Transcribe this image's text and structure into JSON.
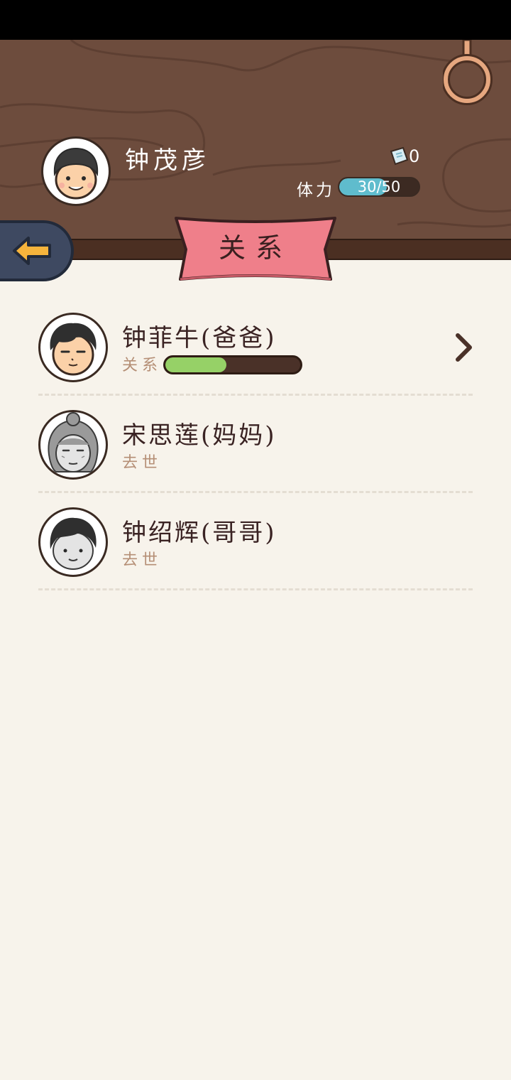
{
  "player": {
    "name": "钟茂彦",
    "ticket_count": "0",
    "stamina_label": "体力",
    "stamina_text": "30/50",
    "stamina_fraction": 0.6
  },
  "title": "关系",
  "relations": [
    {
      "name": "钟菲牛(爸爸)",
      "status": "关系",
      "alive": true,
      "relationship_fraction": 0.45
    },
    {
      "name": "宋思莲(妈妈)",
      "status": "去世",
      "alive": false
    },
    {
      "name": "钟绍辉(哥哥)",
      "status": "去世",
      "alive": false
    }
  ],
  "colors": {
    "wood": "#6d4c3d",
    "banner": "#ef7f8a",
    "stamina": "#5fbccd",
    "relationship": "#96d167",
    "background": "#f7f3eb"
  },
  "icons": [
    "back-arrow-icon",
    "ticket-icon",
    "hook-icon",
    "chevron-right-icon"
  ]
}
